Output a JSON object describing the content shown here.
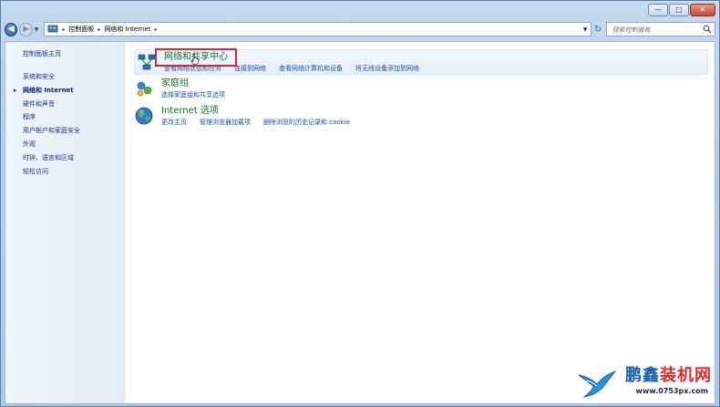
{
  "window": {
    "minimize_glyph": "—",
    "maximize_glyph": "□",
    "close_glyph": "✕"
  },
  "navbar": {
    "breadcrumb": [
      "控制面板",
      "网络和 Internet"
    ],
    "search_placeholder": "搜索控制面板"
  },
  "sidebar": {
    "home": "控制面板主页",
    "items": [
      {
        "label": "系统和安全",
        "active": false
      },
      {
        "label": "网络和 Internet",
        "active": true
      },
      {
        "label": "硬件和声音",
        "active": false
      },
      {
        "label": "程序",
        "active": false
      },
      {
        "label": "用户帐户和家庭安全",
        "active": false
      },
      {
        "label": "外观",
        "active": false
      },
      {
        "label": "时钟、语言和区域",
        "active": false
      },
      {
        "label": "轻松访问",
        "active": false
      }
    ]
  },
  "categories": [
    {
      "title": "网络和共享中心",
      "icon": "network-icon",
      "links": [
        "查看网络状态和任务",
        "连接到网络",
        "查看网络计算机和设备",
        "将无线设备添加到网络"
      ]
    },
    {
      "title": "家庭组",
      "icon": "homegroup-icon",
      "links": [
        "选择家庭组和共享选项"
      ]
    },
    {
      "title": "Internet 选项",
      "icon": "internet-globe-icon",
      "links": [
        "更改主页",
        "管理浏览器加载项",
        "删除浏览的历史记录和 cookie"
      ]
    }
  ],
  "watermark": {
    "brand_a": "鹏鑫",
    "brand_b": "装机网",
    "url": "www.0753px.com"
  },
  "colors": {
    "link": "#1f4fa8",
    "category_title": "#1a6f2c",
    "highlight_box": "#e0242c"
  }
}
